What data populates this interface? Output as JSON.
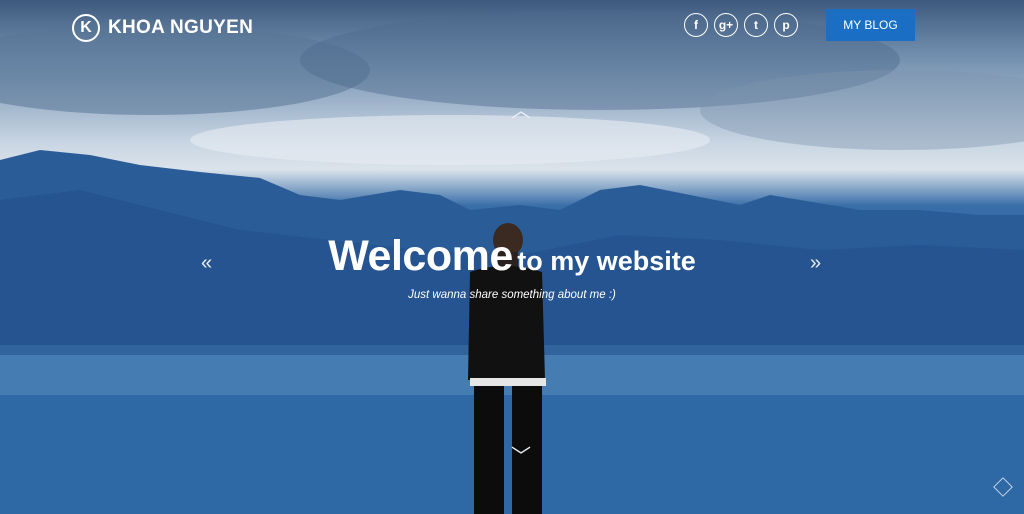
{
  "brand": {
    "logo_letter": "K",
    "name": "KHOA NGUYEN"
  },
  "social": [
    {
      "icon": "facebook-icon",
      "glyph": "f"
    },
    {
      "icon": "google-plus-icon",
      "glyph": "g+"
    },
    {
      "icon": "twitter-icon",
      "glyph": "t"
    },
    {
      "icon": "pinterest-icon",
      "glyph": "p"
    }
  ],
  "nav": {
    "blog_label": "MY BLOG"
  },
  "hero": {
    "title_big": "Welcome",
    "title_rest": "to my website",
    "tagline": "Just wanna share something about me :)"
  },
  "arrows": {
    "up": "︿",
    "down": "﹀",
    "left": "«",
    "right": "»"
  },
  "colors": {
    "button": "#1a6fc4",
    "text": "#ffffff"
  }
}
